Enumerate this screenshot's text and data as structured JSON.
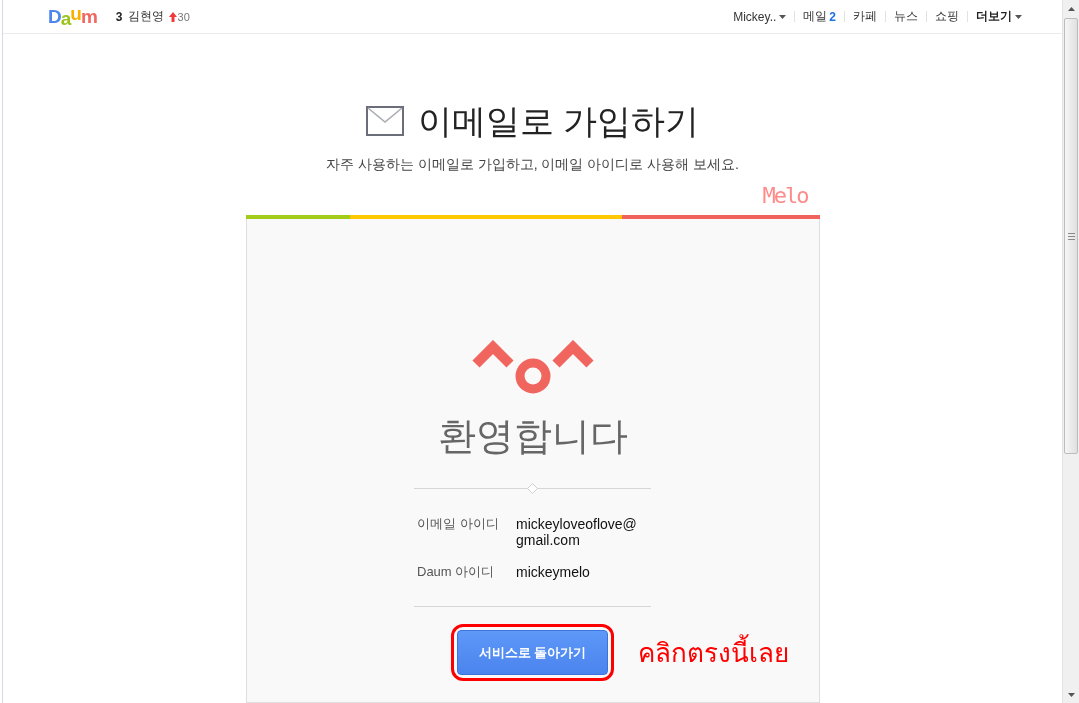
{
  "top_bar": {
    "logo": "Daum",
    "ranking": {
      "number": "3",
      "name": "김현영",
      "rising": true,
      "change": "30"
    },
    "menu": [
      {
        "kind": "account",
        "label": "Mickey.."
      },
      {
        "kind": "link",
        "label": "메일",
        "count": "2"
      },
      {
        "kind": "link",
        "label": "카페"
      },
      {
        "kind": "link",
        "label": "뉴스"
      },
      {
        "kind": "link",
        "label": "쇼핑"
      },
      {
        "kind": "more",
        "label": "더보기"
      }
    ]
  },
  "header": {
    "title": "이메일로 가입하기",
    "subtitle": "자주 사용하는 이메일로 가입하고, 이메일 아이디로 사용해 보세요."
  },
  "signature": "Melo",
  "progress_steps": [
    {
      "color": "#a3cc1a"
    },
    {
      "color": "#ffc800"
    },
    {
      "color": "#f0625b"
    }
  ],
  "card": {
    "welcome": "환영합니다",
    "details": [
      {
        "label": "이메일 아이디",
        "value": "mickeyloveoflove@gmail.com"
      },
      {
        "label": "Daum 아이디",
        "value": "mickeymelo"
      }
    ],
    "button": {
      "label": "서비스로 돌아가기",
      "highlighted": true
    },
    "annotation": "คลิกตรงนี้เลย"
  }
}
